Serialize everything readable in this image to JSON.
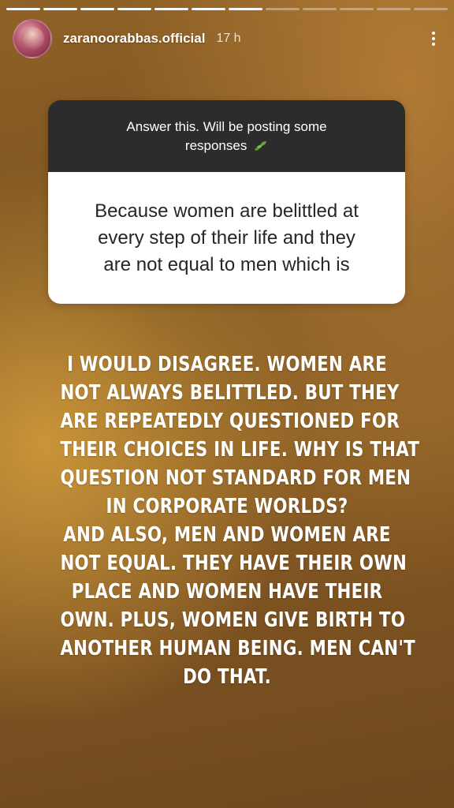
{
  "progress": {
    "total_segments": 12,
    "completed_segments": 7
  },
  "header": {
    "username": "zaranoorabbas.official",
    "time": "17 h",
    "menu_icon": "more-vertical-icon"
  },
  "question_box": {
    "prompt_line1": "Answer this. Will be posting some",
    "prompt_line2": "responses",
    "prompt_emoji": "leaf-icon",
    "response_lines": [
      "Because women are belittled at",
      "every step of their life and they",
      "are not equal to men which is"
    ]
  },
  "reply_lines": [
    "I WOULD DISAGREE. WOMEN ARE",
    "NOT ALWAYS BELITTLED. BUT THEY",
    "ARE REPEATEDLY QUESTIONED FOR",
    "THEIR CHOICES IN LIFE. WHY IS THAT",
    "QUESTION NOT STANDARD FOR MEN",
    "IN CORPORATE WORLDS?",
    "AND ALSO, MEN AND WOMEN ARE",
    "NOT EQUAL. THEY HAVE THEIR OWN",
    "PLACE AND WOMEN HAVE THEIR",
    "OWN. PLUS, WOMEN GIVE BIRTH TO",
    "ANOTHER HUMAN BEING. MEN CAN'T",
    "DO THAT."
  ]
}
